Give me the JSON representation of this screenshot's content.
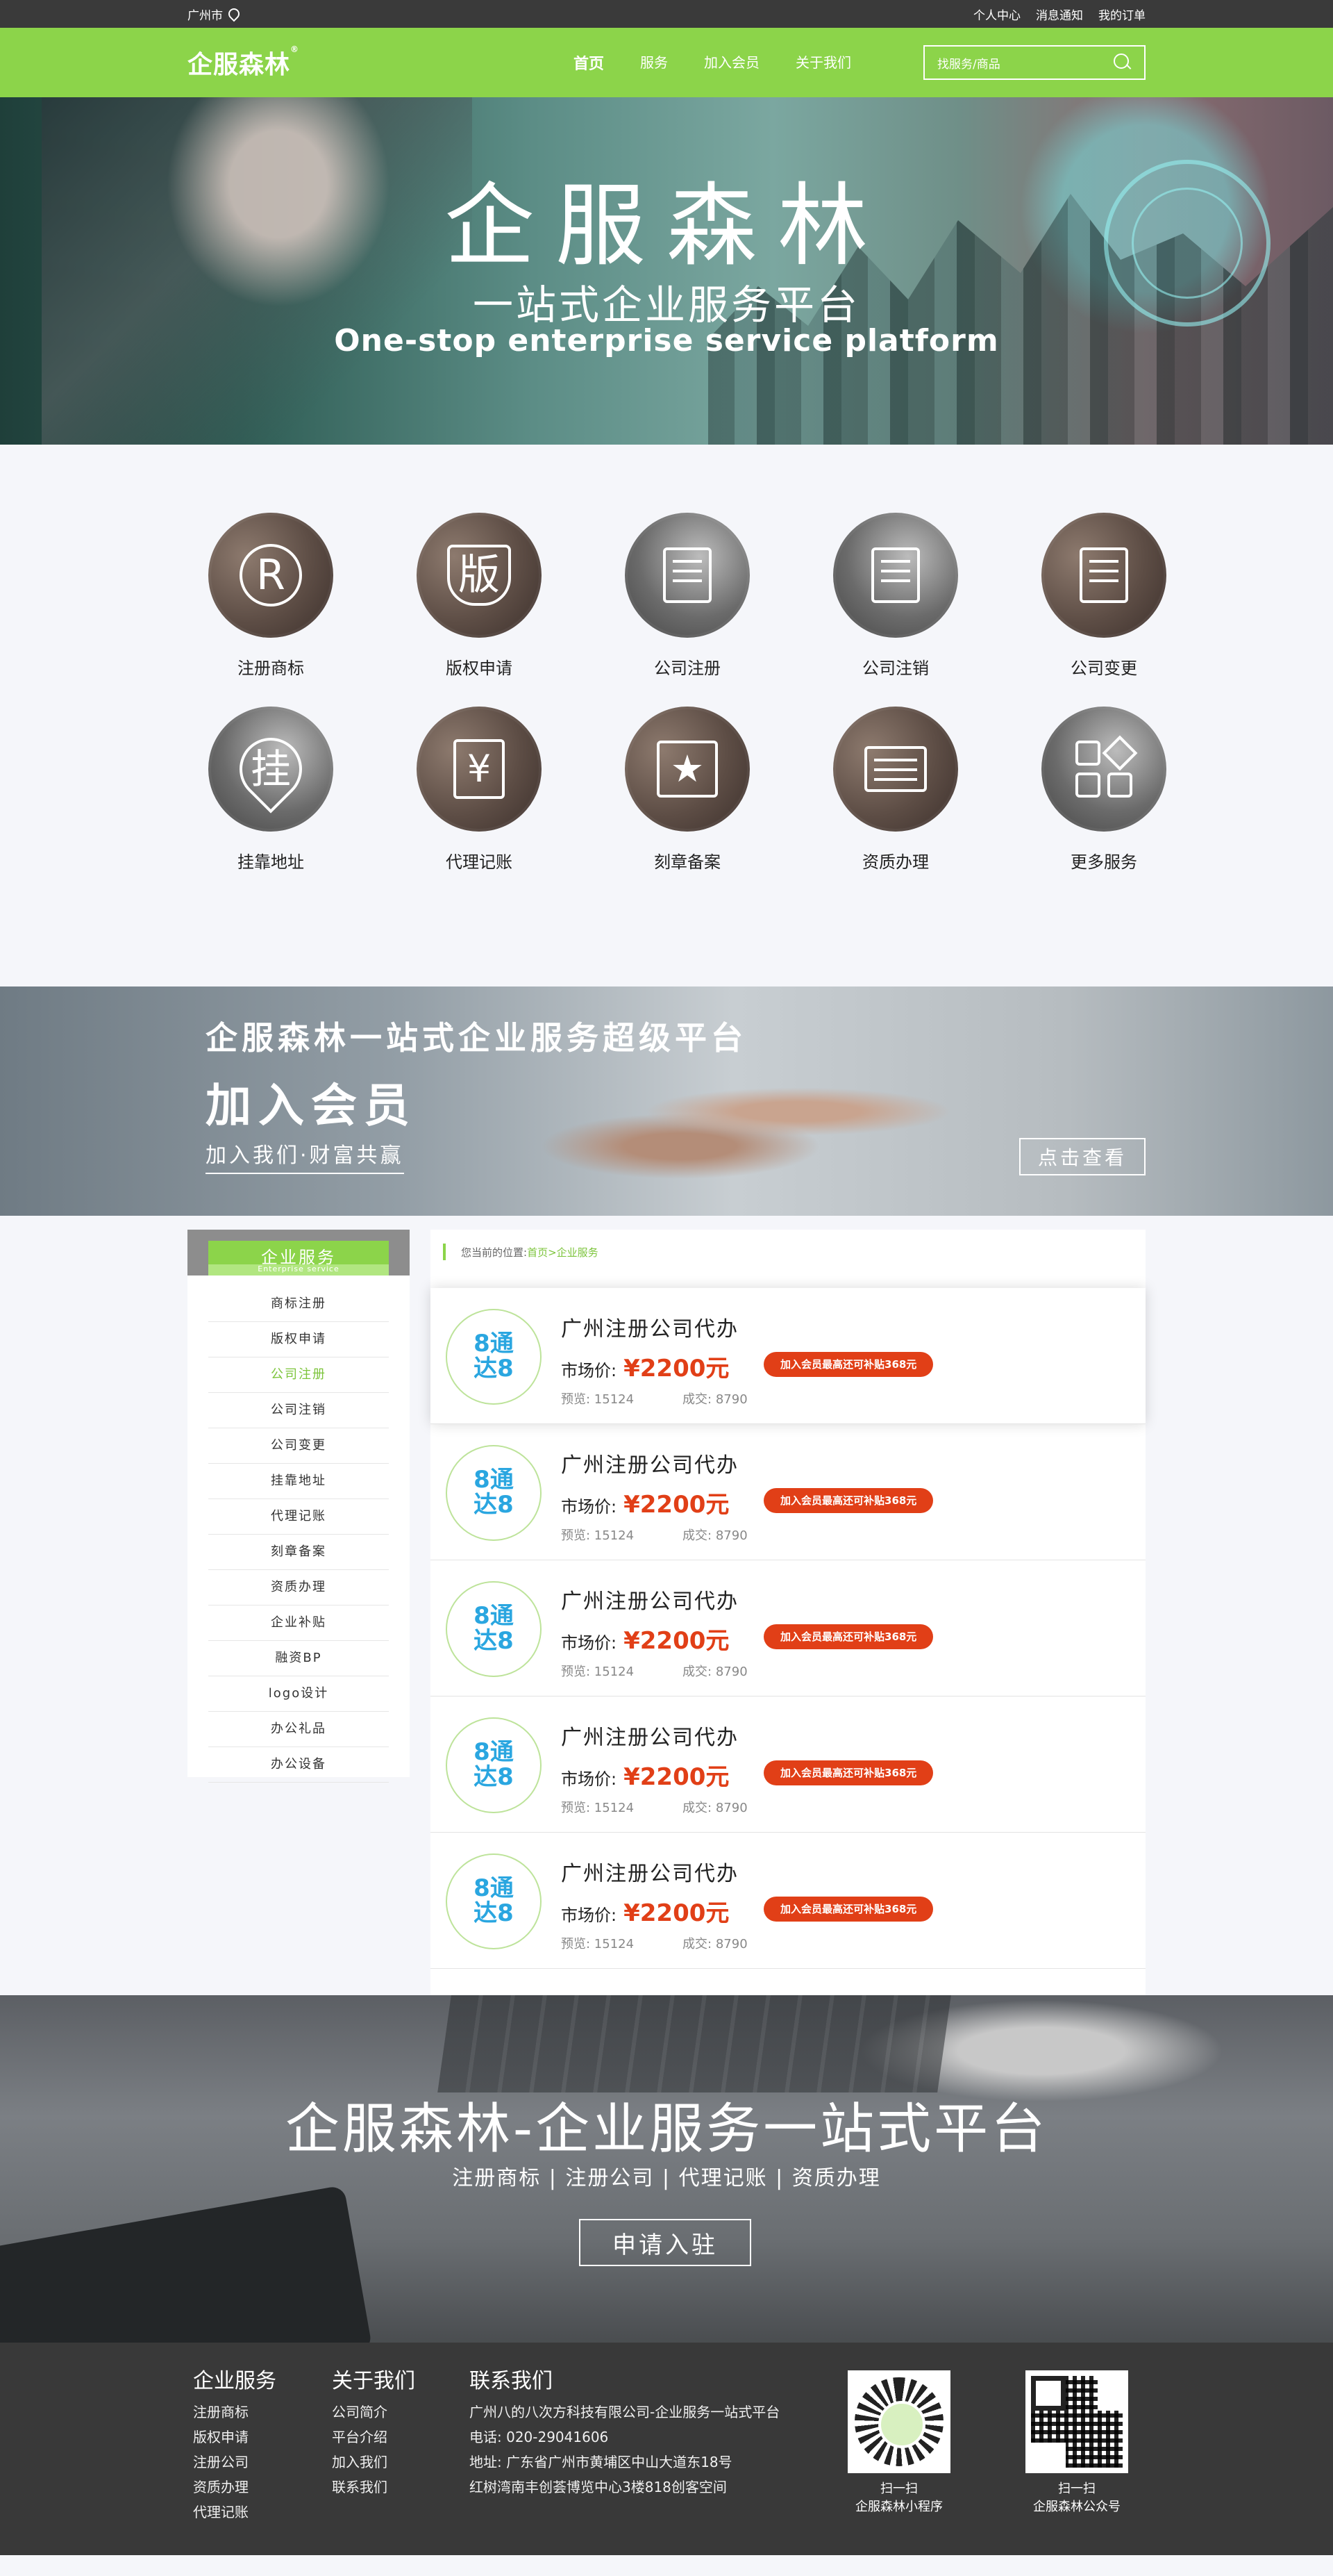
{
  "topbar": {
    "city": "广州市",
    "links": [
      "个人中心",
      "消息通知",
      "我的订单"
    ]
  },
  "nav": {
    "logo": "企服森林",
    "menu": [
      "首页",
      "服务",
      "加入会员",
      "关于我们"
    ],
    "search_placeholder": "找服务/商品"
  },
  "hero": {
    "title": "企服森林",
    "subtitle": "一站式企业服务平台",
    "english": "One-stop enterprise service platform"
  },
  "services": [
    {
      "label": "注册商标",
      "icon": "registered-icon"
    },
    {
      "label": "版权申请",
      "icon": "copyright-shield-icon"
    },
    {
      "label": "公司注册",
      "icon": "building-pen-icon"
    },
    {
      "label": "公司注销",
      "icon": "building-cancel-icon"
    },
    {
      "label": "公司变更",
      "icon": "building-change-icon"
    },
    {
      "label": "挂靠地址",
      "icon": "location-pin-icon"
    },
    {
      "label": "代理记账",
      "icon": "ledger-icon"
    },
    {
      "label": "刻章备案",
      "icon": "stamp-icon"
    },
    {
      "label": "资质办理",
      "icon": "briefcase-icon"
    },
    {
      "label": "更多服务",
      "icon": "grid-more-icon"
    }
  ],
  "member": {
    "title": "企服森林一站式企业服务超级平台",
    "heading": "加入会员",
    "slogan": "加入我们·财富共赢",
    "button": "点击查看"
  },
  "sidebar": {
    "title": "企业服务",
    "subtitle": "Enterprise service",
    "items": [
      "商标注册",
      "版权申请",
      "公司注册",
      "公司注销",
      "公司变更",
      "挂靠地址",
      "代理记账",
      "刻章备案",
      "资质办理",
      "企业补贴",
      "融资BP",
      "logo设计",
      "办公礼品",
      "办公设备"
    ],
    "active": "公司注册"
  },
  "breadcrumb": {
    "prefix": "您当前的位置:",
    "path": "首页>企业服务"
  },
  "products": [
    {
      "logo_line1": "8通",
      "logo_line2": "达8",
      "title": "广州注册公司代办",
      "price_label": "市场价:",
      "price": "¥2200元",
      "tag": "加入会员最高还可补贴368元",
      "views": "预览: 15124",
      "deals": "成交: 8790"
    },
    {
      "logo_line1": "8通",
      "logo_line2": "达8",
      "title": "广州注册公司代办",
      "price_label": "市场价:",
      "price": "¥2200元",
      "tag": "加入会员最高还可补贴368元",
      "views": "预览: 15124",
      "deals": "成交: 8790"
    },
    {
      "logo_line1": "8通",
      "logo_line2": "达8",
      "title": "广州注册公司代办",
      "price_label": "市场价:",
      "price": "¥2200元",
      "tag": "加入会员最高还可补贴368元",
      "views": "预览: 15124",
      "deals": "成交: 8790"
    },
    {
      "logo_line1": "8通",
      "logo_line2": "达8",
      "title": "广州注册公司代办",
      "price_label": "市场价:",
      "price": "¥2200元",
      "tag": "加入会员最高还可补贴368元",
      "views": "预览: 15124",
      "deals": "成交: 8790"
    },
    {
      "logo_line1": "8通",
      "logo_line2": "达8",
      "title": "广州注册公司代办",
      "price_label": "市场价:",
      "price": "¥2200元",
      "tag": "加入会员最高还可补贴368元",
      "views": "预览: 15124",
      "deals": "成交: 8790"
    }
  ],
  "cta": {
    "title": "企服森林-企业服务一站式平台",
    "subtitle": "注册商标 | 注册公司 | 代理记账 | 资质办理",
    "button": "申请入驻"
  },
  "footer": {
    "col1": {
      "title": "企业服务",
      "items": [
        "注册商标",
        "版权申请",
        "注册公司",
        "资质办理",
        "代理记账"
      ]
    },
    "col2": {
      "title": "关于我们",
      "items": [
        "公司简介",
        "平台介绍",
        "加入我们",
        "联系我们"
      ]
    },
    "col3": {
      "title": "联系我们",
      "items": [
        "广州八的八次方科技有限公司-企业服务一站式平台",
        "电话: 020-29041606",
        "地址: 广东省广州市黄埔区中山大道东18号",
        "红树湾南丰创荟博览中心3楼818创客空间"
      ]
    },
    "qr1": {
      "line1": "扫一扫",
      "line2": "企服森林小程序"
    },
    "qr2": {
      "line1": "扫一扫",
      "line2": "企服森林公众号"
    }
  },
  "colors": {
    "brand_green": "#8cd44a",
    "price_red": "#e13f17",
    "dark": "#393939"
  }
}
